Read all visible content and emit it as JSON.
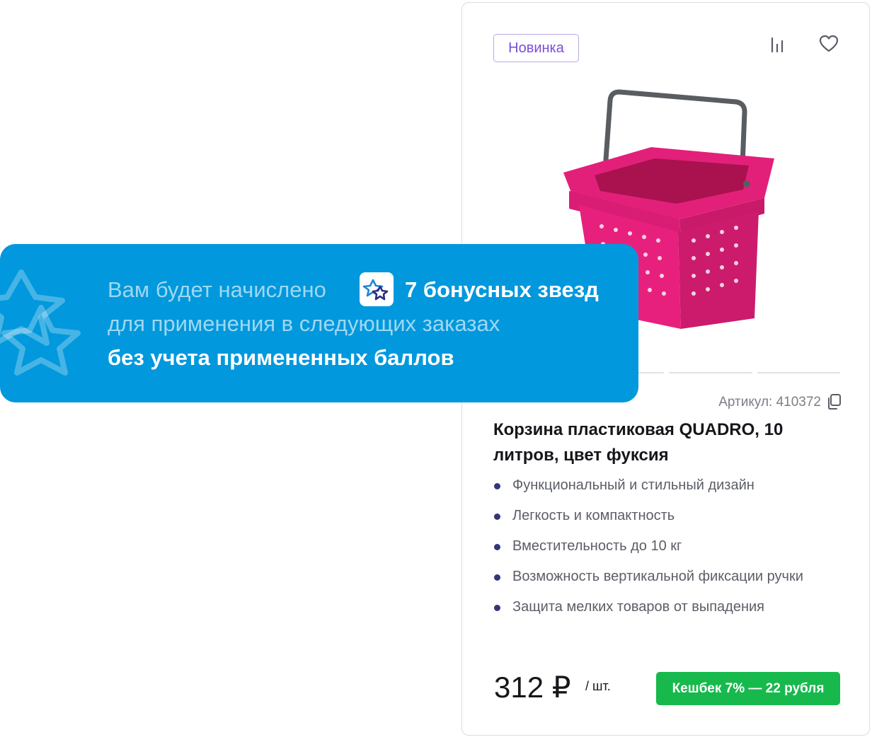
{
  "product_card": {
    "badge": "Новинка",
    "sku": "Артикул: 410372",
    "title": "Корзина пластиковая QUADRO, 10 литров, цвет фуксия",
    "features": [
      "Функциональный и стильный дизайн",
      "Легкость и компактность",
      "Вместительность до 10 кг",
      "Возможность вертикальной фиксации ручки",
      "Защита мелких товаров от выпадения"
    ],
    "price": "312 ₽",
    "unit": "/ шт.",
    "cashback": "Кешбек 7% — 22 рубля"
  },
  "bonus_banner": {
    "line1_prefix": "Вам будет начислено",
    "bonus_amount": "7 бонусных звезд",
    "line2": "для применения в следующих заказах",
    "line3": "без учета примененных баллов"
  },
  "colors": {
    "banner_blue": "#0198dd",
    "cashback_green": "#17b94c",
    "badge_purple": "#7a4fd6",
    "basket_fuchsia": "#e2207a"
  },
  "icons": [
    "compare-icon",
    "heart-icon",
    "copy-icon",
    "star-bonus-icon"
  ]
}
